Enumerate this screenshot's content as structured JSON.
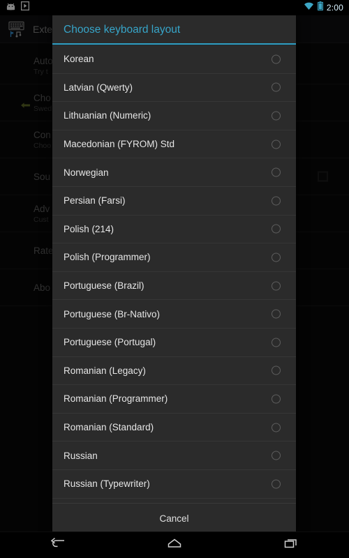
{
  "status_bar": {
    "left_icons": [
      {
        "name": "android-robot-icon",
        "glyph": "android"
      },
      {
        "name": "play-store-icon",
        "glyph": "play-store"
      }
    ],
    "right_icons": [
      {
        "name": "wifi-icon",
        "glyph": "wifi"
      },
      {
        "name": "battery-icon",
        "glyph": "battery"
      }
    ],
    "time": "2:00"
  },
  "background_app": {
    "title": "External",
    "app_icon": "external-keyboard-icon",
    "rows": [
      {
        "title": "Auto",
        "subtitle": "Try t",
        "arrow": false,
        "checkbox": false
      },
      {
        "title": "Cho",
        "subtitle": "Swed",
        "arrow": true,
        "checkbox": false
      },
      {
        "title": "Con",
        "subtitle": "Choo",
        "arrow": false,
        "checkbox": false
      },
      {
        "title": "Sou",
        "subtitle": "",
        "arrow": false,
        "checkbox": true
      },
      {
        "title": "Adv",
        "subtitle": "Cust",
        "arrow": false,
        "checkbox": false
      },
      {
        "title": "Rate",
        "subtitle": "",
        "arrow": false,
        "checkbox": false
      },
      {
        "title": "Abo",
        "subtitle": "",
        "arrow": false,
        "checkbox": false
      }
    ]
  },
  "dialog": {
    "title": "Choose keyboard layout",
    "title_color": "#37a5c9",
    "divider_color": "#2f9dc2",
    "cancel_label": "Cancel",
    "selected_index": -1,
    "items": [
      {
        "label": "Korean",
        "selected": false
      },
      {
        "label": "Latvian (Qwerty)",
        "selected": false
      },
      {
        "label": "Lithuanian (Numeric)",
        "selected": false
      },
      {
        "label": "Macedonian (FYROM) Std",
        "selected": false
      },
      {
        "label": "Norwegian",
        "selected": false
      },
      {
        "label": "Persian (Farsi)",
        "selected": false
      },
      {
        "label": "Polish (214)",
        "selected": false
      },
      {
        "label": "Polish (Programmer)",
        "selected": false
      },
      {
        "label": "Portuguese (Brazil)",
        "selected": false
      },
      {
        "label": "Portuguese (Br-Nativo)",
        "selected": false
      },
      {
        "label": "Portuguese (Portugal)",
        "selected": false
      },
      {
        "label": "Romanian (Legacy)",
        "selected": false
      },
      {
        "label": "Romanian (Programmer)",
        "selected": false
      },
      {
        "label": "Romanian (Standard)",
        "selected": false
      },
      {
        "label": "Russian",
        "selected": false
      },
      {
        "label": "Russian (Typewriter)",
        "selected": false
      },
      {
        "label": "",
        "selected": false
      }
    ]
  },
  "nav_bar": {
    "buttons": [
      {
        "name": "back-button",
        "icon": "back-icon"
      },
      {
        "name": "home-button",
        "icon": "home-icon"
      },
      {
        "name": "recents-button",
        "icon": "recents-icon"
      }
    ]
  }
}
